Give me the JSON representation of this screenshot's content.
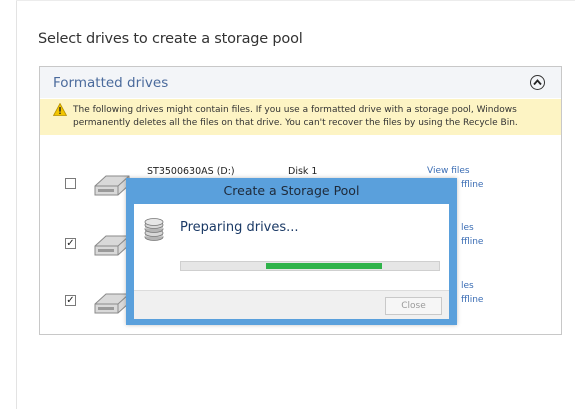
{
  "page": {
    "title": "Select drives to create a storage pool"
  },
  "panel": {
    "header_title": "Formatted drives",
    "warning_text": "The following drives might contain files. If you use a formatted drive with a storage pool, Windows permanently deletes all the files on that drive. You can't recover the files by using the Recycle Bin."
  },
  "drives": [
    {
      "name": "ST3500630AS (D:)",
      "disk": "Disk 1",
      "view_link": "View files",
      "offline_link": "ffline",
      "checked": false,
      "check_glyph": ""
    },
    {
      "name": "",
      "disk": "",
      "view_link": "les",
      "offline_link": "ffline",
      "checked": true,
      "check_glyph": "✓"
    },
    {
      "name": "",
      "disk": "",
      "view_link": "les",
      "offline_link": "ffline",
      "checked": true,
      "check_glyph": "✓"
    }
  ],
  "dialog": {
    "title": "Create a Storage Pool",
    "message": "Preparing drives...",
    "progress_fraction": 0.44,
    "close_label": "Close"
  },
  "colors": {
    "dialog_frame": "#5aa0dc",
    "progress_fill": "#2fb34a",
    "link": "#3b6db4",
    "warning_bg": "#fdf4c4"
  },
  "icons": [
    "warning-icon",
    "chevron-up-icon",
    "hard-drive-icon",
    "storage-pool-icon"
  ]
}
